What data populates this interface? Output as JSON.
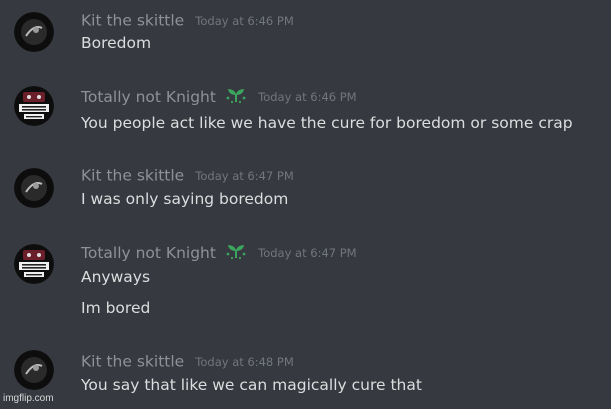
{
  "messages": [
    {
      "author": "Kit the skittle",
      "avatar_icon": "dark-orb-avatar-icon",
      "badge": "",
      "timestamp": "Today at 6:46 PM",
      "lines": [
        "Boredom"
      ]
    },
    {
      "author": "Totally not Knight",
      "avatar_icon": "knight-wing-logo-avatar-icon",
      "badge": "leaf-sprout-badge-icon",
      "timestamp": "Today at 6:46 PM",
      "lines": [
        "You people act like we have the cure for boredom or some crap"
      ]
    },
    {
      "author": "Kit the skittle",
      "avatar_icon": "dark-orb-avatar-icon",
      "badge": "",
      "timestamp": "Today at 6:47 PM",
      "lines": [
        "I was only saying boredom"
      ]
    },
    {
      "author": "Totally not Knight",
      "avatar_icon": "knight-wing-logo-avatar-icon",
      "badge": "leaf-sprout-badge-icon",
      "timestamp": "Today at 6:47 PM",
      "lines": [
        "Anyways",
        "Im bored"
      ]
    },
    {
      "author": "Kit the skittle",
      "avatar_icon": "dark-orb-avatar-icon",
      "badge": "",
      "timestamp": "Today at 6:48 PM",
      "lines": [
        "You say that like we can magically cure that"
      ]
    }
  ],
  "watermark": "imgflip.com",
  "colors": {
    "background": "#36393f",
    "username": "#8e9297",
    "timestamp": "#72767d",
    "message_text": "#dcddde",
    "badge_green": "#3ba55d"
  }
}
